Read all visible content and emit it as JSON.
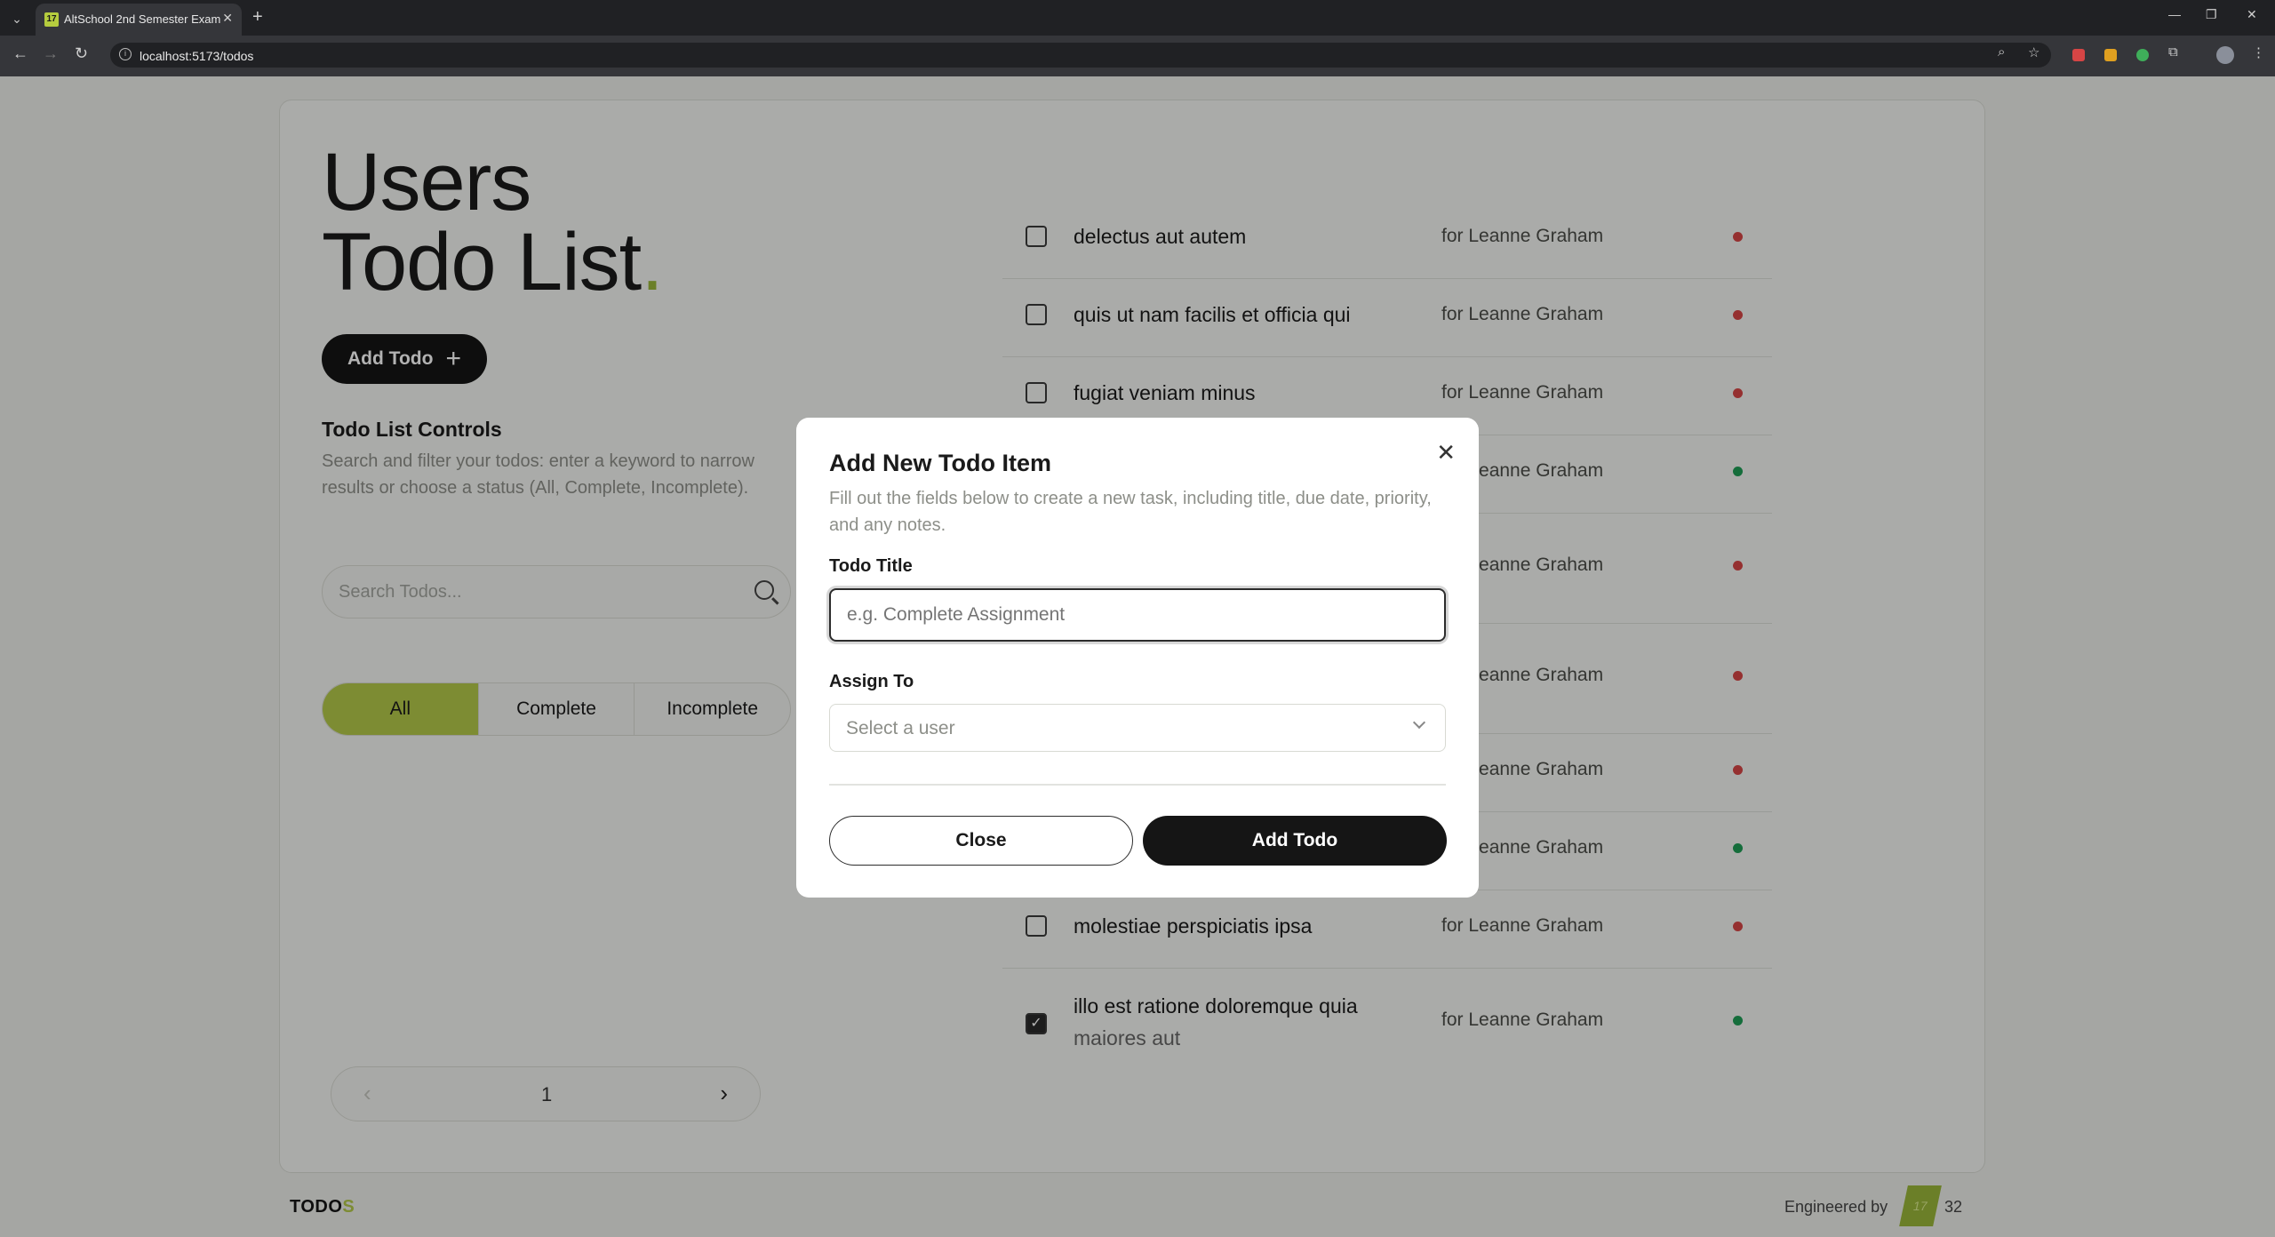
{
  "browser": {
    "tab_title": "AltSchool 2nd Semester Exam",
    "favicon_text": "17",
    "url": "localhost:5173/todos"
  },
  "page": {
    "headline_line1": "Users",
    "headline_line2": "Todo List",
    "headline_dot": ".",
    "add_todo_label": "Add Todo",
    "controls_title": "Todo List Controls",
    "controls_desc": "Search and filter your todos: enter a keyword to narrow results or choose a status (All, Complete, Incomplete).",
    "search_placeholder": "Search Todos...",
    "filters": [
      "All",
      "Complete",
      "Incomplete"
    ],
    "active_filter": "All",
    "pager": {
      "prev": "‹",
      "current": "1",
      "next": "›"
    }
  },
  "todos": [
    {
      "title": "delectus aut autem",
      "subtitle": "",
      "user": "for Leanne Graham",
      "completed": false,
      "status_color": "#d64545"
    },
    {
      "title": "quis ut nam facilis et officia qui",
      "subtitle": "",
      "user": "for Leanne Graham",
      "completed": false,
      "status_color": "#d64545"
    },
    {
      "title": "fugiat veniam minus",
      "subtitle": "",
      "user": "for Leanne Graham",
      "completed": false,
      "status_color": "#d64545"
    },
    {
      "title": "",
      "subtitle": "",
      "user": "for Leanne Graham",
      "completed": true,
      "status_color": "#1f9d55"
    },
    {
      "title": "",
      "subtitle": "",
      "user": "for Leanne Graham",
      "completed": false,
      "status_color": "#d64545"
    },
    {
      "title": "",
      "subtitle": "",
      "user": "for Leanne Graham",
      "completed": false,
      "status_color": "#d64545"
    },
    {
      "title": "",
      "subtitle": "",
      "user": "for Leanne Graham",
      "completed": false,
      "status_color": "#d64545"
    },
    {
      "title": "",
      "subtitle": "",
      "user": "for Leanne Graham",
      "completed": true,
      "status_color": "#1f9d55"
    },
    {
      "title": "molestiae perspiciatis ipsa",
      "subtitle": "",
      "user": "for Leanne Graham",
      "completed": false,
      "status_color": "#d64545"
    },
    {
      "title": "illo est ratione doloremque quia",
      "subtitle": "maiores aut",
      "user": "for Leanne Graham",
      "completed": true,
      "status_color": "#1f9d55"
    }
  ],
  "modal": {
    "title": "Add New Todo Item",
    "description": "Fill out the fields below to create a new task, including title, due date, priority, and any notes.",
    "todo_title_label": "Todo Title",
    "todo_title_placeholder": "e.g. Complete Assignment",
    "assign_to_label": "Assign To",
    "assign_to_value": "Select a user",
    "close_label": "Close",
    "add_label": "Add Todo"
  },
  "footer": {
    "logo_main": "TODO",
    "logo_accent": "S",
    "engineered_by": "Engineered by",
    "badge_text": "17",
    "badge_number": "32"
  },
  "colors": {
    "accent": "#b3c94a",
    "dark_button": "#151515",
    "status_incomplete": "#d64545",
    "status_complete": "#1f9d55"
  }
}
